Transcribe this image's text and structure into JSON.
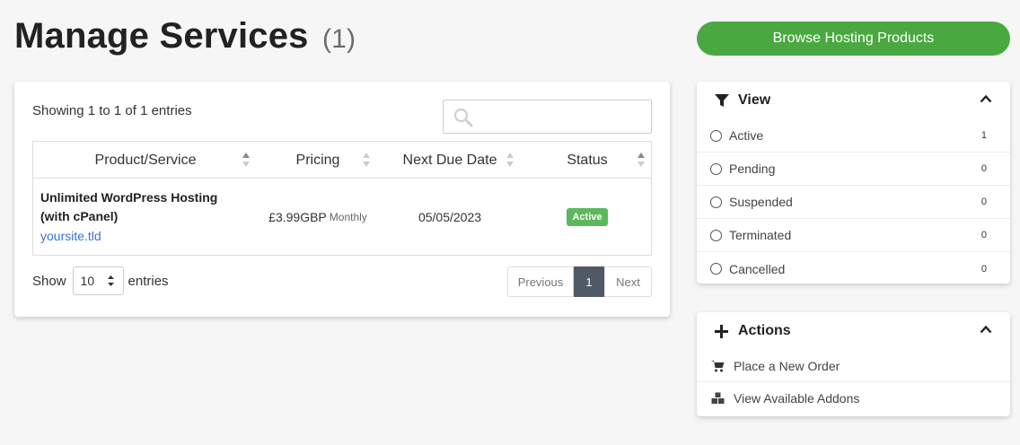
{
  "header": {
    "title": "Manage Services",
    "count": "(1)",
    "browse_button": "Browse Hosting Products"
  },
  "colors": {
    "primary_green": "#49a940",
    "link_blue": "#3b71d6",
    "active_badge": "#5cb85c",
    "pager_active": "#4f5a66"
  },
  "table": {
    "showing_text": "Showing 1 to 1 of 1 entries",
    "search_placeholder": "",
    "columns": [
      "Product/Service",
      "Pricing",
      "Next Due Date",
      "Status"
    ],
    "rows": [
      {
        "product_line1": "Unlimited WordPress Hosting",
        "product_line2": "(with cPanel)",
        "domain": "yoursite.tld",
        "price": "£3.99GBP",
        "cycle": "Monthly",
        "due_date": "05/05/2023",
        "status": "Active"
      }
    ],
    "show_label": "Show",
    "entries_label": "entries",
    "page_size": "10",
    "pager": {
      "previous": "Previous",
      "current": "1",
      "next": "Next"
    }
  },
  "view_panel": {
    "title": "View",
    "items": [
      {
        "label": "Active",
        "count": "1"
      },
      {
        "label": "Pending",
        "count": "0"
      },
      {
        "label": "Suspended",
        "count": "0"
      },
      {
        "label": "Terminated",
        "count": "0"
      },
      {
        "label": "Cancelled",
        "count": "0"
      }
    ]
  },
  "actions_panel": {
    "title": "Actions",
    "items": [
      {
        "label": "Place a New Order",
        "icon": "cart-icon"
      },
      {
        "label": "View Available Addons",
        "icon": "cubes-icon"
      }
    ]
  }
}
